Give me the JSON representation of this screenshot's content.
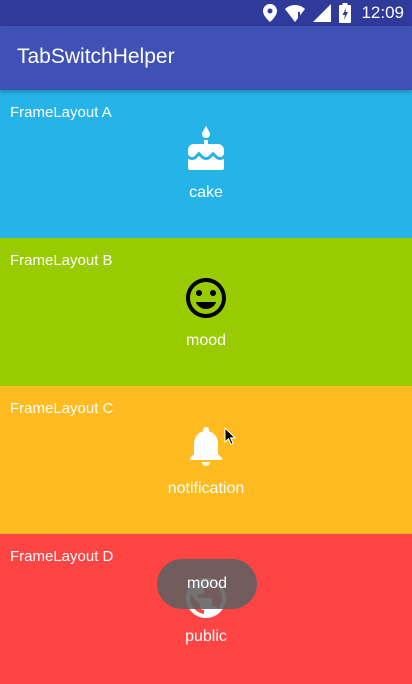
{
  "status_bar": {
    "time": "12:09",
    "icons": [
      "location-icon",
      "wifi-icon",
      "signal-icon",
      "battery-icon"
    ]
  },
  "app_bar": {
    "title": "TabSwitchHelper"
  },
  "frames": [
    {
      "label": "FrameLayout A",
      "icon": "cake-icon",
      "caption": "cake",
      "color": "#26b4e8"
    },
    {
      "label": "FrameLayout B",
      "icon": "mood-icon",
      "caption": "mood",
      "color": "#99cc00"
    },
    {
      "label": "FrameLayout C",
      "icon": "notification-icon",
      "caption": "notification",
      "color": "#ffbb1f"
    },
    {
      "label": "FrameLayout D",
      "icon": "public-icon",
      "caption": "public",
      "color": "#ff4444"
    }
  ],
  "toast": {
    "text": "mood"
  },
  "colors": {
    "status_bar": "#2f3a9a",
    "app_bar": "#3f51b5"
  }
}
